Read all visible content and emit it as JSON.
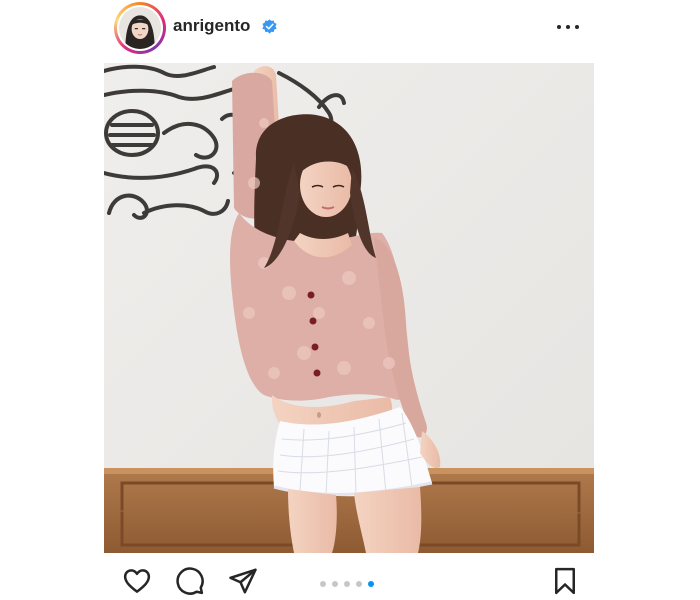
{
  "post": {
    "username": "anrigento",
    "verified": true,
    "carousel": {
      "count": 5,
      "active_index": 4
    }
  },
  "icons": {
    "menu": "more-horizontal-icon",
    "like": "heart-icon",
    "comment": "comment-icon",
    "share": "send-icon",
    "save": "bookmark-icon",
    "badge": "verified-badge-icon"
  },
  "colors": {
    "text": "#262626",
    "verified": "#3897f0",
    "dot_active": "#0095f6",
    "dot_inactive": "#c7c7c7"
  }
}
